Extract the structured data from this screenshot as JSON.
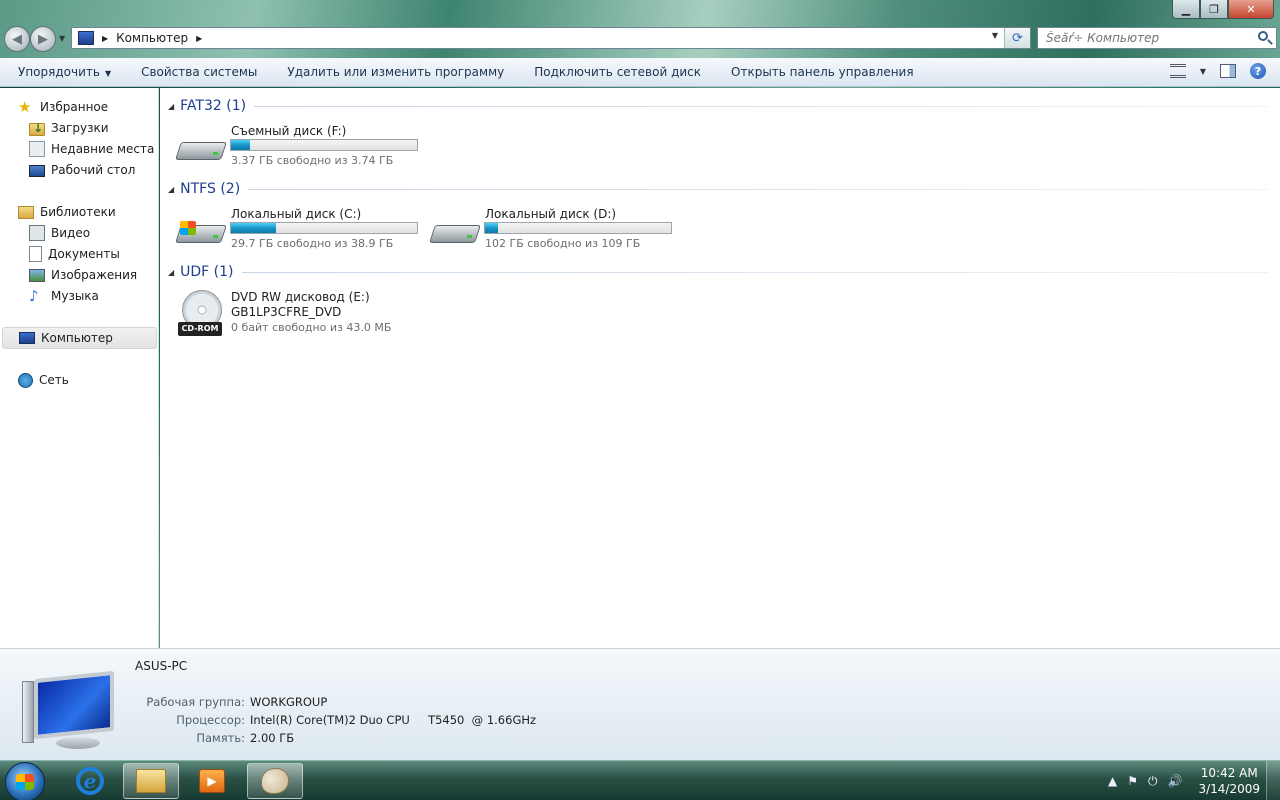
{
  "address": {
    "location": "Компьютер"
  },
  "search": {
    "placeholder": "Šeăŕ÷ Компьютер"
  },
  "toolbar": {
    "organize": "Упорядочить",
    "system_properties": "Свойства системы",
    "uninstall": "Удалить или изменить программу",
    "map_drive": "Подключить сетевой диск",
    "control_panel": "Открыть панель управления"
  },
  "sidebar": {
    "favorites": "Избранное",
    "downloads": "Загрузки",
    "recent": "Недавние места",
    "desktop": "Рабочий стол",
    "libraries": "Библиотеки",
    "video": "Видео",
    "documents": "Документы",
    "pictures": "Изображения",
    "music": "Музыка",
    "computer": "Компьютер",
    "network": "Сеть"
  },
  "groups": {
    "fat32": {
      "title": "FAT32 (1)",
      "drive_f": {
        "name": "Съемный диск (F:)",
        "free": "3.37 ГБ свободно из 3.74 ГБ",
        "used_fraction": 0.1
      }
    },
    "ntfs": {
      "title": "NTFS (2)",
      "drive_c": {
        "name": "Локальный диск (C:)",
        "free": "29.7 ГБ свободно из 38.9 ГБ",
        "used_fraction": 0.24
      },
      "drive_d": {
        "name": "Локальный диск (D:)",
        "free": "102 ГБ свободно из 109 ГБ",
        "used_fraction": 0.07
      }
    },
    "udf": {
      "title": "UDF (1)",
      "drive_e": {
        "name": "DVD RW дисковод (E:)",
        "label": "GB1LP3CFRE_DVD",
        "free": "0 байт свободно из 43.0 МБ",
        "badge": "CD-ROM"
      }
    }
  },
  "details": {
    "pc_name": "ASUS-PC",
    "workgroup_label": "Рабочая группа:",
    "workgroup": "WORKGROUP",
    "cpu_label": "Процессор:",
    "cpu": "Intel(R) Core(TM)2 Duo CPU     T5450  @ 1.66GHz",
    "ram_label": "Память:",
    "ram": "2.00 ГБ"
  },
  "taskbar": {
    "time": "10:42 AM",
    "date": "3/14/2009"
  }
}
